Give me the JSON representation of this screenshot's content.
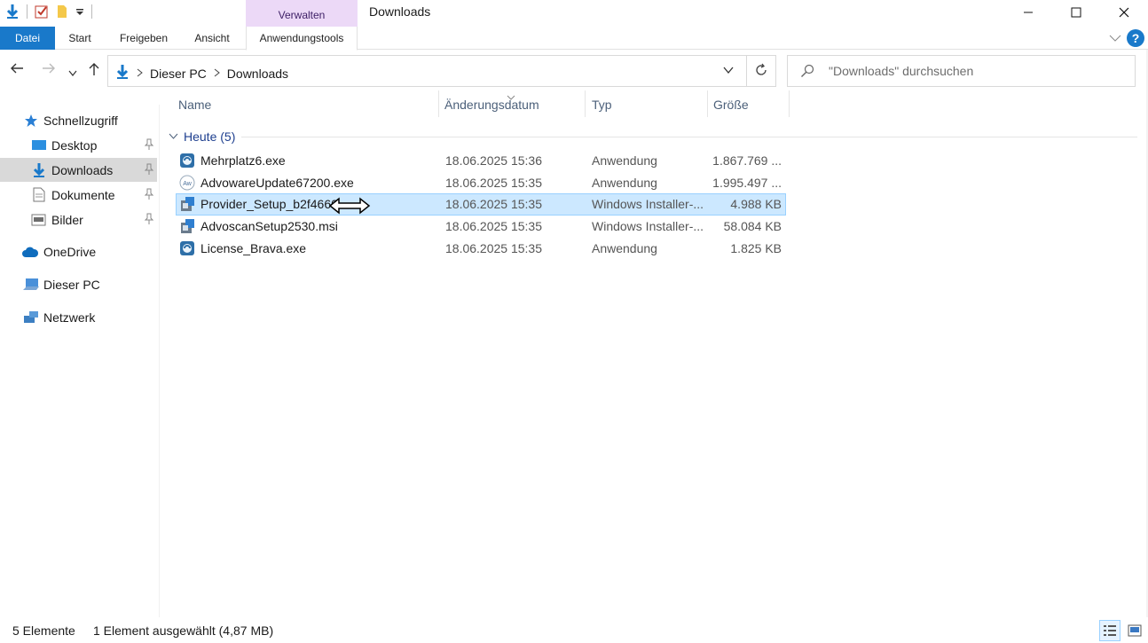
{
  "window": {
    "title": "Downloads",
    "context_tab_group": "Verwalten"
  },
  "ribbon": {
    "tabs": [
      "Datei",
      "Start",
      "Freigeben",
      "Ansicht",
      "Anwendungstools"
    ],
    "help": "?"
  },
  "address": {
    "crumbs": [
      "Dieser PC",
      "Downloads"
    ]
  },
  "search": {
    "placeholder": "\"Downloads\" durchsuchen"
  },
  "sidebar": {
    "items": [
      {
        "label": "Schnellzugriff",
        "icon": "star-icon"
      },
      {
        "label": "Desktop",
        "icon": "desktop-icon",
        "pinned": true
      },
      {
        "label": "Downloads",
        "icon": "download-arrow-icon",
        "pinned": true,
        "selected": true
      },
      {
        "label": "Dokumente",
        "icon": "document-icon",
        "pinned": true
      },
      {
        "label": "Bilder",
        "icon": "pictures-icon",
        "pinned": true
      },
      {
        "label": "OneDrive",
        "icon": "cloud-icon"
      },
      {
        "label": "Dieser PC",
        "icon": "computer-icon"
      },
      {
        "label": "Netzwerk",
        "icon": "network-icon"
      }
    ]
  },
  "columns": [
    "Name",
    "Änderungsdatum",
    "Typ",
    "Größe"
  ],
  "group": {
    "label": "Heute (5)"
  },
  "files": [
    {
      "name": "Mehrplatz6.exe",
      "date": "18.06.2025 15:36",
      "type": "Anwendung",
      "size": "1.867.769 ...",
      "icon": "app-icon"
    },
    {
      "name": "AdvowareUpdate67200.exe",
      "date": "18.06.2025 15:35",
      "type": "Anwendung",
      "size": "1.995.497 ...",
      "icon": "advoware-icon"
    },
    {
      "name": "Provider_Setup_b2f4660",
      "date": "18.06.2025 15:35",
      "type": "Windows Installer-...",
      "size": "4.988 KB",
      "icon": "msi-icon",
      "selected": true
    },
    {
      "name": "AdvoscanSetup2530.msi",
      "date": "18.06.2025 15:35",
      "type": "Windows Installer-...",
      "size": "58.084 KB",
      "icon": "msi-icon"
    },
    {
      "name": "License_Brava.exe",
      "date": "18.06.2025 15:35",
      "type": "Anwendung",
      "size": "1.825 KB",
      "icon": "app-icon"
    }
  ],
  "status": {
    "count": "5 Elemente",
    "selection": "1 Element ausgewählt (4,87 MB)"
  },
  "colors": {
    "accent": "#1979ca",
    "context_tab": "#ecd9f7",
    "selection": "#cce8ff",
    "group_text": "#1e3f8f"
  }
}
